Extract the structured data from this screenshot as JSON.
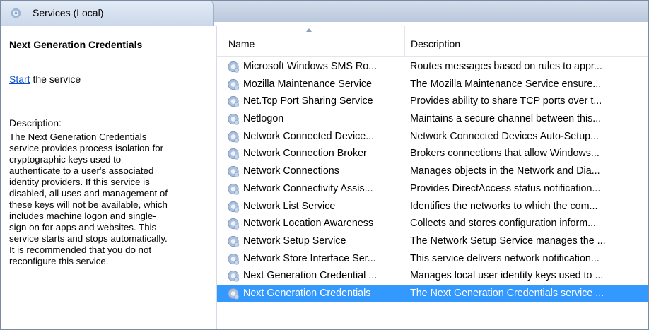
{
  "window": {
    "title": "Services (Local)",
    "icon": "services-gear-icon"
  },
  "left_panel": {
    "service_name": "Next Generation Credentials",
    "start_link": "Start",
    "start_suffix": " the service",
    "description_label": "Description:",
    "description_lines": [
      "The Next Generation Credentials",
      "service provides process isolation for",
      "cryptographic keys used to",
      "authenticate to a user's associated",
      "identity providers. If this service is",
      "disabled, all uses and management of",
      "these keys will not be available, which",
      "includes machine logon and single-",
      "sign on for apps and websites. This",
      "service starts and stops automatically.",
      "It is recommended that you do not",
      "reconfigure this service."
    ]
  },
  "table": {
    "columns": [
      "Name",
      "Description"
    ],
    "rows": [
      {
        "name": "Microsoft Windows SMS Ro...",
        "description": "Routes messages based on rules to appr..."
      },
      {
        "name": "Mozilla Maintenance Service",
        "description": "The Mozilla Maintenance Service ensure..."
      },
      {
        "name": "Net.Tcp Port Sharing Service",
        "description": "Provides ability to share TCP ports over t..."
      },
      {
        "name": "Netlogon",
        "description": "Maintains a secure channel between this..."
      },
      {
        "name": "Network Connected Device...",
        "description": "Network Connected Devices Auto-Setup..."
      },
      {
        "name": "Network Connection Broker",
        "description": "Brokers connections that allow Windows..."
      },
      {
        "name": "Network Connections",
        "description": "Manages objects in the Network and Dia..."
      },
      {
        "name": "Network Connectivity Assis...",
        "description": "Provides DirectAccess status notification..."
      },
      {
        "name": "Network List Service",
        "description": "Identifies the networks to which the com..."
      },
      {
        "name": "Network Location Awareness",
        "description": "Collects and stores configuration inform..."
      },
      {
        "name": "Network Setup Service",
        "description": "The Network Setup Service manages the ..."
      },
      {
        "name": "Network Store Interface Ser...",
        "description": "This service delivers network notification..."
      },
      {
        "name": "Next Generation Credential ...",
        "description": "Manages local user identity keys used to ..."
      },
      {
        "name": "Next Generation Credentials",
        "description": "The Next Generation Credentials service ...",
        "selected": true
      }
    ]
  },
  "colors": {
    "selection": "#3399ff",
    "link": "#0b50c8",
    "header_bar": "#c8d5e8"
  }
}
